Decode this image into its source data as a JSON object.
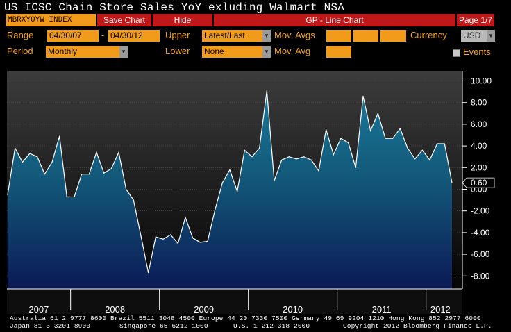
{
  "window": {
    "title": "US ICSC Chain Store Sales YoY exluding Walmart NSA",
    "ticker": "MBRXYOYW INDEX",
    "save_chart_label": "Save Chart",
    "hide_label": "Hide",
    "chart_type_label": "GP - Line Chart",
    "page_indicator": "Page 1/7"
  },
  "controls": {
    "range_label": "Range",
    "range_start": "04/30/07",
    "range_sep": "-",
    "range_end": "04/30/12",
    "upper_label": "Upper",
    "upper_value": "Latest/Last",
    "mov_avgs_label": "Mov. Avgs",
    "currency_label": "Currency",
    "currency_value": "USD",
    "period_label": "Period",
    "period_value": "Monthly",
    "lower_label": "Lower",
    "lower_value": "None",
    "mov_avg_label": "Mov. Avg",
    "events_label": "Events"
  },
  "colors": {
    "orange": "#f29b1b",
    "amber_text": "#f4a21e",
    "red_button": "#c01818",
    "line": "#ffffff",
    "fill_top": "#1b7fa0",
    "fill_bottom": "#0b1a55"
  },
  "chart_data": {
    "type": "area",
    "title": "US ICSC Chain Store Sales YoY exluding Walmart NSA",
    "ylim": [
      -9,
      10.5
    ],
    "grid": true,
    "y_ticks": [
      "10.00",
      "8.00",
      "6.00",
      "4.00",
      "2.00",
      "0.00",
      "-2.00",
      "-4.00",
      "-6.00",
      "-8.00"
    ],
    "y_tick_values": [
      10,
      8,
      6,
      4,
      2,
      0,
      -2,
      -4,
      -6,
      -8
    ],
    "x_labels": [
      "2007",
      "2008",
      "2009",
      "2010",
      "2011",
      "2012"
    ],
    "last_value_label": "0.60",
    "series": [
      {
        "x": [
          "2007-04",
          "2007-05",
          "2007-06",
          "2007-07",
          "2007-08",
          "2007-09",
          "2007-10",
          "2007-11",
          "2007-12",
          "2008-01",
          "2008-02",
          "2008-03",
          "2008-04",
          "2008-05",
          "2008-06",
          "2008-07",
          "2008-08",
          "2008-09",
          "2008-10",
          "2008-11",
          "2008-12",
          "2009-01",
          "2009-02",
          "2009-03",
          "2009-04",
          "2009-05",
          "2009-06",
          "2009-07",
          "2009-08",
          "2009-09",
          "2009-10",
          "2009-11",
          "2009-12",
          "2010-01",
          "2010-02",
          "2010-03",
          "2010-04",
          "2010-05",
          "2010-06",
          "2010-07",
          "2010-08",
          "2010-09",
          "2010-10",
          "2010-11",
          "2010-12",
          "2011-01",
          "2011-02",
          "2011-03",
          "2011-04",
          "2011-05",
          "2011-06",
          "2011-07",
          "2011-08",
          "2011-09",
          "2011-10",
          "2011-11",
          "2011-12",
          "2012-01",
          "2012-02",
          "2012-03",
          "2012-04"
        ],
        "values": [
          -0.5,
          3.8,
          2.5,
          3.3,
          3.0,
          1.4,
          2.5,
          4.9,
          -0.7,
          -0.7,
          1.4,
          1.4,
          3.4,
          1.5,
          1.9,
          3.4,
          0.0,
          -1.0,
          -4.3,
          -7.7,
          -4.4,
          -4.6,
          -4.2,
          -5.0,
          -2.6,
          -4.5,
          -4.9,
          -4.8,
          -1.9,
          0.6,
          1.8,
          -0.2,
          3.6,
          3.0,
          3.8,
          9.1,
          0.8,
          2.7,
          3.0,
          2.8,
          3.0,
          2.7,
          1.7,
          5.5,
          3.2,
          4.7,
          4.3,
          2.0,
          8.6,
          5.4,
          7.0,
          4.7,
          4.7,
          5.6,
          3.8,
          2.8,
          3.6,
          2.7,
          4.2,
          4.2,
          0.6
        ]
      }
    ]
  },
  "footer": {
    "line1": "Australia 61 2 9777 8600 Brazil 5511 3048 4500 Europe 44 20 7330 7500 Germany 49 69 9204 1210 Hong Kong 852 2977 6000",
    "line2_left": "Japan 81 3 3201 8900",
    "line2_mid": "Singapore 65 6212 1000",
    "line2_us": "U.S. 1 212 318 2000",
    "line2_right": "Copyright 2012 Bloomberg Finance L.P."
  }
}
